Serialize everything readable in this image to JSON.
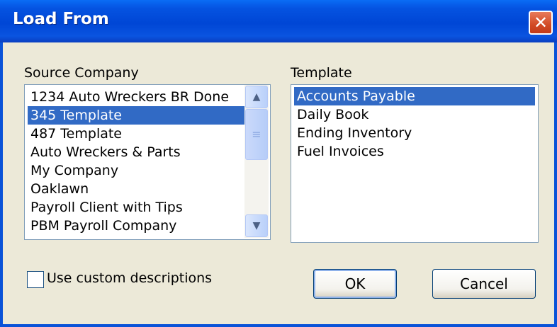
{
  "window": {
    "title": "Load From",
    "close_glyph": "✕"
  },
  "source_company": {
    "label": "Source Company",
    "items": [
      {
        "label": "1234 Auto Wreckers BR Done",
        "selected": false
      },
      {
        "label": "345 Template",
        "selected": true
      },
      {
        "label": "487 Template",
        "selected": false
      },
      {
        "label": "Auto Wreckers & Parts",
        "selected": false
      },
      {
        "label": "My Company",
        "selected": false
      },
      {
        "label": "Oaklawn",
        "selected": false
      },
      {
        "label": "Payroll Client with Tips",
        "selected": false
      },
      {
        "label": "PBM Payroll Company",
        "selected": false
      }
    ],
    "scroll": {
      "up_glyph": "▲",
      "down_glyph": "▼",
      "thumb_glyph": "≡"
    }
  },
  "template": {
    "label": "Template",
    "items": [
      {
        "label": "Accounts Payable",
        "selected": true
      },
      {
        "label": "Daily Book",
        "selected": false
      },
      {
        "label": "Ending Inventory",
        "selected": false
      },
      {
        "label": "Fuel Invoices",
        "selected": false
      }
    ]
  },
  "options": {
    "custom_descriptions_label": "Use custom descriptions",
    "custom_descriptions_checked": false
  },
  "buttons": {
    "ok_label": "OK",
    "cancel_label": "Cancel"
  },
  "colors": {
    "title_bar": "#0054e3",
    "selection": "#316ac5",
    "dialog_bg": "#ece9d8",
    "close_button": "#d24a25"
  }
}
